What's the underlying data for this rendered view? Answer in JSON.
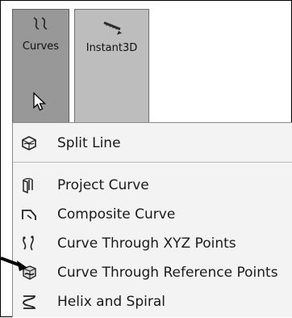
{
  "toolbar": {
    "buttons": [
      {
        "label": "Curves",
        "icon": "curves-icon"
      },
      {
        "label": "Instant3D",
        "icon": "instant3d-icon"
      }
    ]
  },
  "menu": {
    "items": [
      {
        "label": "Split Line",
        "icon": "split-line-icon"
      },
      {
        "label": "Project Curve",
        "icon": "project-curve-icon"
      },
      {
        "label": "Composite Curve",
        "icon": "composite-curve-icon"
      },
      {
        "label": "Curve Through XYZ Points",
        "icon": "curve-xyz-points-icon"
      },
      {
        "label": "Curve Through Reference Points",
        "icon": "curve-reference-points-icon"
      },
      {
        "label": "Helix and Spiral",
        "icon": "helix-spiral-icon"
      }
    ]
  },
  "colors": {
    "curves_button": "#989898",
    "instant3d_button": "#bdbdbd",
    "menu_background": "#f3f3f3",
    "annotation_arrow": "#000000"
  }
}
